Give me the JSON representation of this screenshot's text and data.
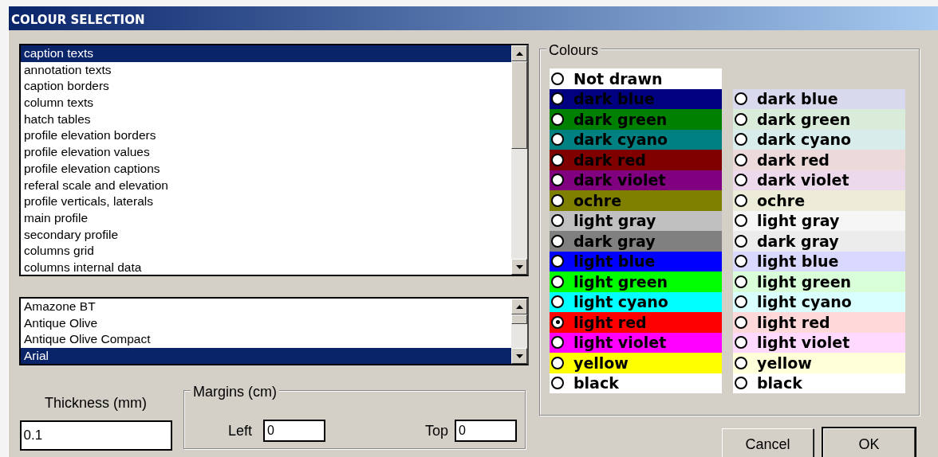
{
  "window": {
    "title": "COLOUR SELECTION"
  },
  "elements_list": [
    {
      "label": "caption texts",
      "selected": true
    },
    {
      "label": "annotation texts",
      "selected": false
    },
    {
      "label": "caption borders",
      "selected": false
    },
    {
      "label": "column texts",
      "selected": false
    },
    {
      "label": "hatch tables",
      "selected": false
    },
    {
      "label": "profile elevation borders",
      "selected": false
    },
    {
      "label": "profile elevation values",
      "selected": false
    },
    {
      "label": "profile elevation captions",
      "selected": false
    },
    {
      "label": "referal scale and elevation",
      "selected": false
    },
    {
      "label": "profile verticals, laterals",
      "selected": false
    },
    {
      "label": "main profile",
      "selected": false
    },
    {
      "label": "secondary profile",
      "selected": false
    },
    {
      "label": "columns grid",
      "selected": false
    },
    {
      "label": "columns internal data",
      "selected": false
    }
  ],
  "fonts_list": [
    {
      "label": "Amazone BT",
      "selected": false
    },
    {
      "label": "Antique Olive",
      "selected": false
    },
    {
      "label": "Antique Olive Compact",
      "selected": false
    },
    {
      "label": "Arial",
      "selected": true
    }
  ],
  "thickness": {
    "label": "Thickness (mm)",
    "value": "0.1"
  },
  "margins": {
    "title": "Margins (cm)",
    "left_label": "Left",
    "left_value": "0",
    "top_label": "Top",
    "top_value": "0"
  },
  "colours": {
    "title": "Colours",
    "column_1": [
      {
        "label": "Not drawn",
        "color": "#ffffff",
        "selected": false
      },
      {
        "label": "dark blue",
        "color": "#000080",
        "selected": false
      },
      {
        "label": "dark green",
        "color": "#008000",
        "selected": false
      },
      {
        "label": "dark cyano",
        "color": "#008080",
        "selected": false
      },
      {
        "label": "dark red",
        "color": "#800000",
        "selected": false
      },
      {
        "label": "dark violet",
        "color": "#800080",
        "selected": false
      },
      {
        "label": "ochre",
        "color": "#808000",
        "selected": false
      },
      {
        "label": "light gray",
        "color": "#c0c0c0",
        "selected": false
      },
      {
        "label": "dark gray",
        "color": "#808080",
        "selected": false
      },
      {
        "label": "light blue",
        "color": "#0000ff",
        "selected": false
      },
      {
        "label": "light green",
        "color": "#00ff00",
        "selected": false
      },
      {
        "label": "light cyano",
        "color": "#00ffff",
        "selected": false
      },
      {
        "label": "light red",
        "color": "#ff0000",
        "selected": true
      },
      {
        "label": "light violet",
        "color": "#ff00ff",
        "selected": false
      },
      {
        "label": "yellow",
        "color": "#ffff00",
        "selected": false
      },
      {
        "label": "black",
        "color": "#ffffff",
        "selected": false
      }
    ],
    "column_2": [
      {
        "label": "dark blue",
        "color": "#d9d9ee",
        "selected": false
      },
      {
        "label": "dark green",
        "color": "#d9ecd9",
        "selected": false
      },
      {
        "label": "dark cyano",
        "color": "#d9ecec",
        "selected": false
      },
      {
        "label": "dark red",
        "color": "#ecd9d9",
        "selected": false
      },
      {
        "label": "dark violet",
        "color": "#ecd9ec",
        "selected": false
      },
      {
        "label": "ochre",
        "color": "#ececd9",
        "selected": false
      },
      {
        "label": "light gray",
        "color": "#f6f6f6",
        "selected": false
      },
      {
        "label": "dark gray",
        "color": "#ececec",
        "selected": false
      },
      {
        "label": "light blue",
        "color": "#d9d9ff",
        "selected": false
      },
      {
        "label": "light green",
        "color": "#d9ffd9",
        "selected": false
      },
      {
        "label": "light cyano",
        "color": "#d9ffff",
        "selected": false
      },
      {
        "label": "light red",
        "color": "#ffd9d9",
        "selected": false
      },
      {
        "label": "light violet",
        "color": "#ffd9ff",
        "selected": false
      },
      {
        "label": "yellow",
        "color": "#ffffd9",
        "selected": false
      },
      {
        "label": "black",
        "color": "#ffffff",
        "selected": false
      }
    ]
  },
  "buttons": [
    "Cancel",
    "OK"
  ]
}
